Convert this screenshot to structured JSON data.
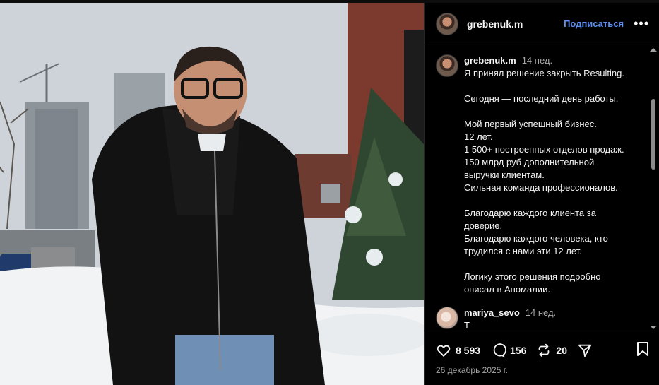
{
  "post": {
    "author": "grebenuk.m",
    "follow_label": "Подписаться",
    "more_label": "•••",
    "photo_description_icon": "photo",
    "caption": {
      "username": "grebenuk.m",
      "time": "14 нед.",
      "lines": [
        "Я принял решение закрыть Resulting.",
        "",
        "Сегодня — последний день работы.",
        "",
        "Мой первый успешный бизнес.",
        "12 лет.",
        "1 500+ построенных отделов продаж.",
        "150 млрд руб дополнительной",
        "выручки клиентам.",
        "Сильная команда профессионалов.",
        "",
        "Благодарю каждого клиента за",
        "доверие.",
        "Благодарю каждого человека, кто",
        "трудился с нами эти 12 лет.",
        "",
        "Логику этого решения подробно",
        "описал в Аномалии."
      ]
    },
    "comments": [
      {
        "username": "mariya_sevo",
        "time": "14 нед.",
        "text": "Т  "
      }
    ],
    "stats": {
      "likes": "8 593",
      "comments": "156",
      "reposts": "20"
    },
    "date": "26 декабрь 2025 г.",
    "icons": {
      "like": "heart-icon",
      "comment": "comment-icon",
      "repost": "repost-icon",
      "share": "send-icon",
      "save": "bookmark-icon",
      "more": "more-icon"
    },
    "colors": {
      "background": "#000000",
      "follow": "#5b8ff0",
      "muted": "#a8a8a8"
    }
  }
}
